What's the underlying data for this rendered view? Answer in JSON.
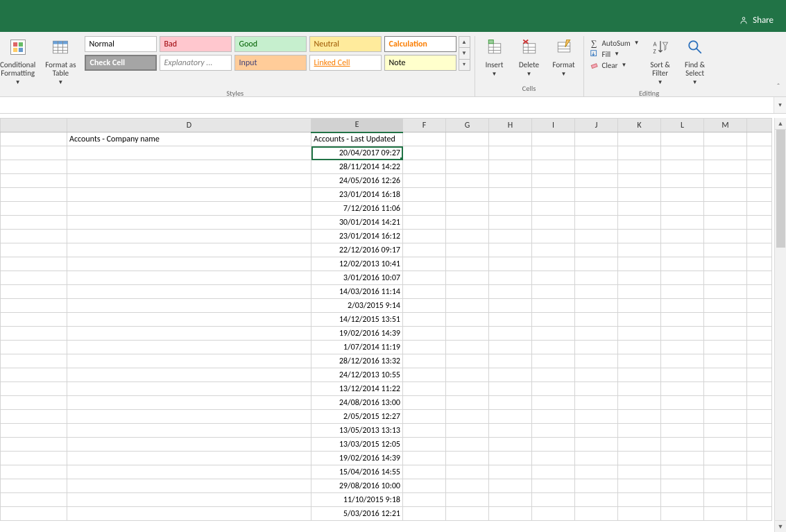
{
  "title": "",
  "share_label": "Share",
  "ribbon": {
    "conditional_label": "Conditional\nFormatting",
    "formatas_label": "Format as\nTable",
    "styles": {
      "normal": "Normal",
      "bad": "Bad",
      "good": "Good",
      "neutral": "Neutral",
      "calculation": "Calculation",
      "checkcell": "Check Cell",
      "explanatory": "Explanatory ...",
      "input": "Input",
      "linkedcell": "Linked Cell",
      "note": "Note"
    },
    "group_styles": "Styles",
    "insert": "Insert",
    "delete": "Delete",
    "format": "Format",
    "group_cells": "Cells",
    "autosum": "AutoSum",
    "fill": "Fill",
    "clear": "Clear",
    "sortfilter": "Sort &\nFilter",
    "findselect": "Find &\nSelect",
    "group_editing": "Editing"
  },
  "columns": [
    "D",
    "E",
    "F",
    "G",
    "H",
    "I",
    "J",
    "K",
    "L",
    "M"
  ],
  "headers": {
    "D": "Accounts - Company name",
    "E": "Accounts - Last Updated"
  },
  "data_E": [
    "20/04/2017  09:27",
    "28/11/2014  14:22",
    "24/05/2016  12:26",
    "23/01/2014  16:18",
    "7/12/2016 11:06",
    "30/01/2014  14:21",
    "23/01/2014  16:12",
    "22/12/2016  09:17",
    "12/02/2013 10:41",
    "3/01/2016 10:07",
    "14/03/2016  11:14",
    "2/03/2015 9:14",
    "14/12/2015  13:51",
    "19/02/2016  14:39",
    "1/07/2014 11:19",
    "28/12/2016  13:32",
    "24/12/2013  10:55",
    "13/12/2014  11:22",
    "24/08/2016  13:00",
    "2/05/2015 12:27",
    "13/05/2013  13:13",
    "13/03/2015  12:05",
    "19/02/2016  14:39",
    "15/04/2016  14:55",
    "29/08/2016  10:00",
    "11/10/2015 9:18",
    "5/03/2016 12:21"
  ],
  "colors": {
    "normal_bg": "#ffffff",
    "normal_fg": "#000000",
    "bad_bg": "#ffc7ce",
    "bad_fg": "#9c0006",
    "good_bg": "#c6efce",
    "good_fg": "#006100",
    "neutral_bg": "#ffeb9c",
    "neutral_fg": "#9c5700",
    "calc_bg": "#ffffff",
    "calc_fg": "#fa7d00",
    "calc_border": "#7f7f7f",
    "check_bg": "#a5a5a5",
    "check_fg": "#ffffff",
    "expl_bg": "#ffffff",
    "expl_fg": "#7f7f7f",
    "input_bg": "#ffcc99",
    "input_fg": "#3f3f76",
    "linked_bg": "#ffffff",
    "linked_fg": "#fa7d00",
    "note_bg": "#ffffcc",
    "note_fg": "#000000"
  }
}
